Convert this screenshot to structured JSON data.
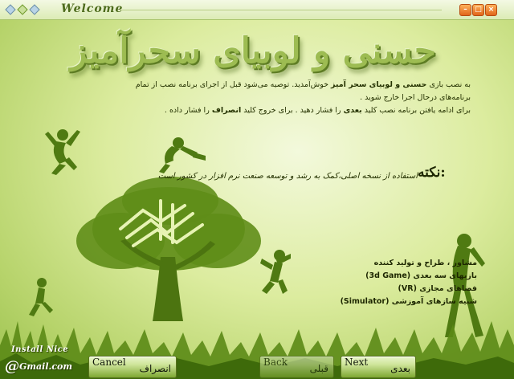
{
  "window": {
    "title": "Welcome",
    "minimize_icon": "minimize-icon",
    "maximize_icon": "maximize-icon",
    "close_icon": "close-icon"
  },
  "main": {
    "heading": "حسنی و لوبیای سحرآمیز",
    "intro_line1_a": "به نصب بازی",
    "intro_line1_b": "حسنی و لوبیای سحر آمیز",
    "intro_line1_c": "خوش‌آمدید. توصیه می‌شود قبل از اجرای برنامه نصب از تمام برنامه‌های درحال اجرا خارج شوید .",
    "intro_line2_a": "برای ادامه یافتن برنامه نصب کلید",
    "intro_line2_b": "بعدی",
    "intro_line2_c": "را فشار دهید . برای خروج کلید",
    "intro_line2_d": "انصراف",
    "intro_line2_e": "را فشار داده .",
    "note_title": "نکته:",
    "note_text": "استفاده از نسخه اصلی،کمک به رشد و  توسعه صنعت نرم افزار در کشور است",
    "credits": [
      "مشاور ، طراح و تولید کننده",
      "بازیهای سه بعدی (3d Game)",
      "فضاهای مجازی (VR)",
      "شبیه سازهای آموزشی (Simulator)"
    ]
  },
  "footer": {
    "install_nice": "Install Nice",
    "gmail": "Gmail.com",
    "gmail_at": "@"
  },
  "buttons": {
    "cancel_en": "Cancel",
    "cancel_fa": "انصراف",
    "back_en": "Back",
    "back_fa": "قبلی",
    "next_en": "Next",
    "next_fa": "بعدی"
  },
  "colors": {
    "background": "#cfe38d",
    "silhouette": "#4f7a12",
    "text": "#243100"
  }
}
